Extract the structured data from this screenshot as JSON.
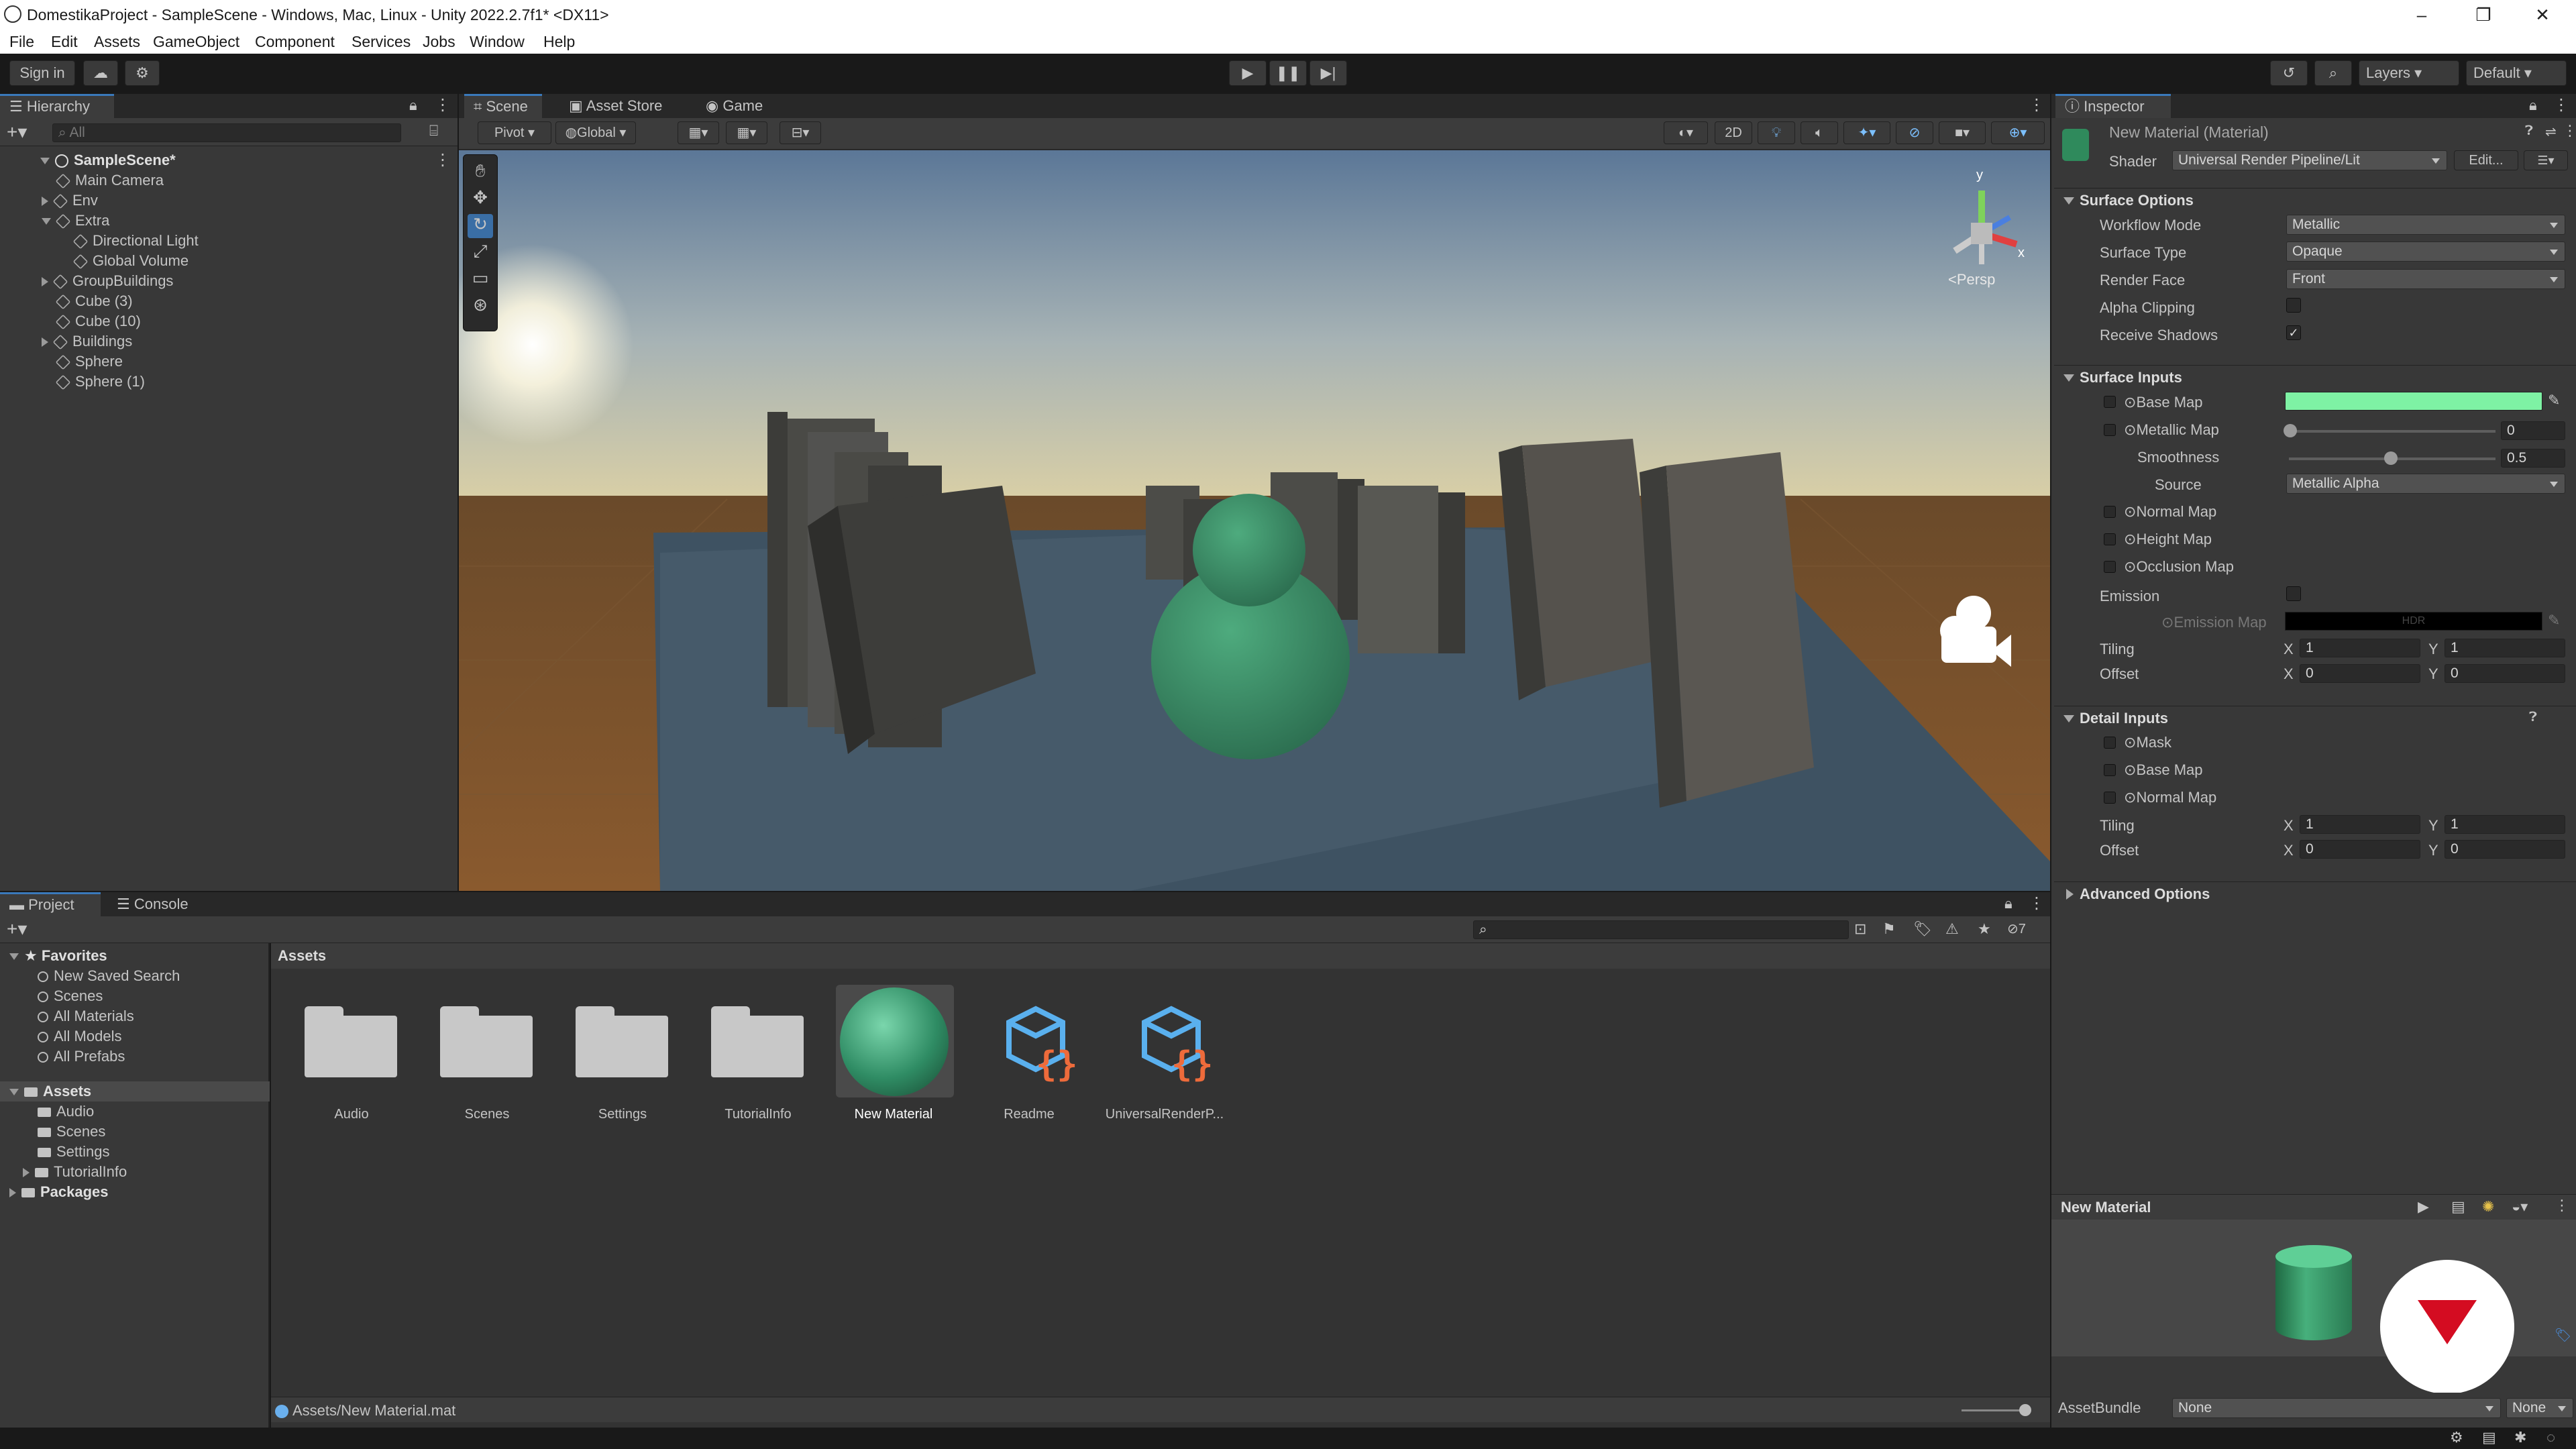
{
  "window": {
    "title": "DomestikaProject - SampleScene - Windows, Mac, Linux - Unity 2022.2.7f1* <DX11>",
    "controls": [
      "–",
      "❐",
      "✕"
    ]
  },
  "menu": [
    "File",
    "Edit",
    "Assets",
    "GameObject",
    "Component",
    "Services",
    "Jobs",
    "Window",
    "Help"
  ],
  "toolbar": {
    "sign_in": "Sign in",
    "layers": "Layers",
    "layout": "Default"
  },
  "hierarchy": {
    "tab": "Hierarchy",
    "search_placeholder": "All",
    "scene": "SampleScene*",
    "items": [
      {
        "label": "Main Camera",
        "depth": 1,
        "arrow": ""
      },
      {
        "label": "Env",
        "depth": 1,
        "arrow": "closed"
      },
      {
        "label": "Extra",
        "depth": 1,
        "arrow": "open"
      },
      {
        "label": "Directional Light",
        "depth": 2,
        "arrow": ""
      },
      {
        "label": "Global Volume",
        "depth": 2,
        "arrow": ""
      },
      {
        "label": "GroupBuildings",
        "depth": 1,
        "arrow": "closed"
      },
      {
        "label": "Cube (3)",
        "depth": 1,
        "arrow": ""
      },
      {
        "label": "Cube (10)",
        "depth": 1,
        "arrow": ""
      },
      {
        "label": "Buildings",
        "depth": 1,
        "arrow": "closed"
      },
      {
        "label": "Sphere",
        "depth": 1,
        "arrow": ""
      },
      {
        "label": "Sphere (1)",
        "depth": 1,
        "arrow": ""
      }
    ]
  },
  "scene_view": {
    "tabs": [
      "Scene",
      "Asset Store",
      "Game"
    ],
    "pivot": "Pivot",
    "global": "Global",
    "mode_2d": "2D",
    "persp": "<Persp",
    "axis_x": "x",
    "axis_y": "y"
  },
  "inspector": {
    "tab": "Inspector",
    "material_name": "New Material (Material)",
    "shader_label": "Shader",
    "shader_value": "Universal Render Pipeline/Lit",
    "edit_button": "Edit...",
    "surface_options": {
      "title": "Surface Options",
      "workflow_mode_label": "Workflow Mode",
      "workflow_mode": "Metallic",
      "surface_type_label": "Surface Type",
      "surface_type": "Opaque",
      "render_face_label": "Render Face",
      "render_face": "Front",
      "alpha_clipping_label": "Alpha Clipping",
      "receive_shadows_label": "Receive Shadows",
      "receive_shadows_checked": "✓"
    },
    "surface_inputs": {
      "title": "Surface Inputs",
      "base_map": "Base Map",
      "base_color": "#7ef2a4",
      "metallic_map": "Metallic Map",
      "metallic_value": "0",
      "smoothness_label": "Smoothness",
      "smoothness_value": "0.5",
      "source_label": "Source",
      "source_value": "Metallic Alpha",
      "normal_map": "Normal Map",
      "height_map": "Height Map",
      "occlusion_map": "Occlusion Map",
      "emission_label": "Emission",
      "emission_map": "Emission Map",
      "hdr": "HDR",
      "tiling_label": "Tiling",
      "offset_label": "Offset",
      "tiling_x": "1",
      "tiling_y": "1",
      "offset_x": "0",
      "offset_y": "0",
      "x": "X",
      "y": "Y"
    },
    "detail_inputs": {
      "title": "Detail Inputs",
      "mask": "Mask",
      "base_map": "Base Map",
      "normal_map": "Normal Map",
      "tiling_label": "Tiling",
      "offset_label": "Offset",
      "tiling_x": "1",
      "tiling_y": "1",
      "offset_x": "0",
      "offset_y": "0"
    },
    "advanced_options": "Advanced Options",
    "preview_title": "New Material",
    "assetbundle_label": "AssetBundle",
    "assetbundle_value": "None",
    "assetbundle_variant": "None"
  },
  "project": {
    "tabs": [
      "Project",
      "Console"
    ],
    "favorites_title": "Favorites",
    "favorites": [
      "New Saved Search",
      "Scenes",
      "All Materials",
      "All Models",
      "All Prefabs"
    ],
    "assets_title": "Assets",
    "assets_tree": [
      "Audio",
      "Scenes",
      "Settings",
      "TutorialInfo"
    ],
    "packages": "Packages",
    "breadcrumb": "Assets",
    "grid_items": [
      "Audio",
      "Scenes",
      "Settings",
      "TutorialInfo",
      "New Material",
      "Readme",
      "UniversalRenderP..."
    ],
    "status_path": "Assets/New Material.mat",
    "hidden_count": "7"
  }
}
